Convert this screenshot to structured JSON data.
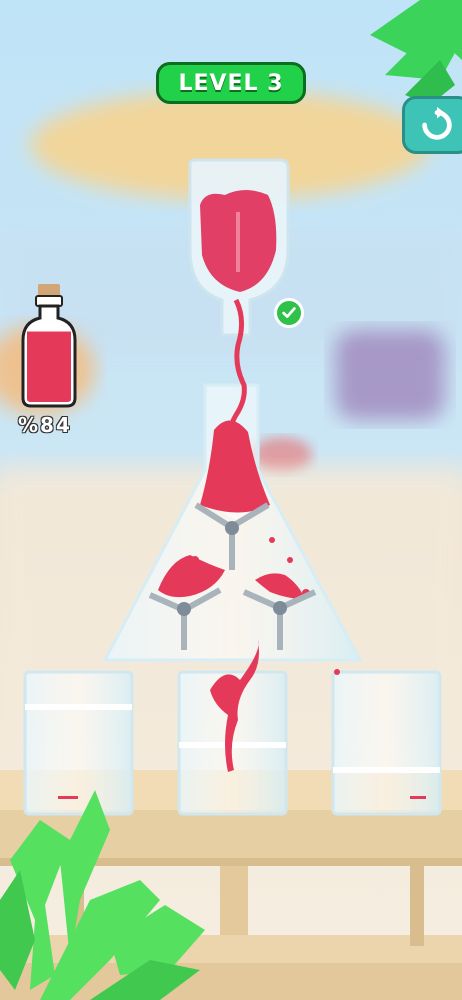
{
  "hud": {
    "level_label": "LEVEL 3",
    "fill_percent_text": "%84",
    "fill_fraction": 0.84
  },
  "icons": {
    "restart": "restart-icon",
    "check": "check-icon",
    "bottle": "bottle-icon"
  },
  "colors": {
    "liquid": "#e5395a",
    "level_badge": "#22d14a",
    "restart_button": "#3ec4b6",
    "glass": "#cfe8f0"
  }
}
